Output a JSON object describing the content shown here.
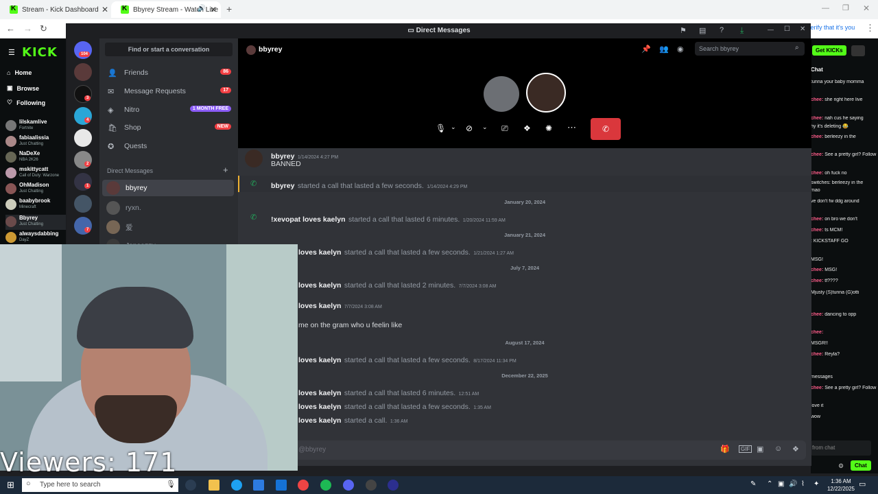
{
  "browser": {
    "tabs": [
      {
        "title": "Stream - Kick Dashboard"
      },
      {
        "title": "Bbyrey Stream - Watch Live"
      }
    ],
    "verify_text": "Verify that it's you"
  },
  "kick": {
    "logo": "KICK",
    "nav": [
      "Home",
      "Browse",
      "Following"
    ],
    "channels": [
      {
        "name": "lilskamlive",
        "category": "Fortnite"
      },
      {
        "name": "fabiaalissia",
        "category": "Just Chatting"
      },
      {
        "name": "NaDeXe",
        "category": "NBA 2K26"
      },
      {
        "name": "mskittycatt",
        "category": "Call of Duty: Warzone"
      },
      {
        "name": "OhMadison",
        "category": "Just Chatting"
      },
      {
        "name": "baabybrook",
        "category": "Minecraft"
      },
      {
        "name": "Bbyrey",
        "category": "Just Chatting"
      },
      {
        "name": "alwaysdabbing",
        "category": "DayZ"
      }
    ],
    "get_kicks": "Get KICKs",
    "chat_header": "Chat",
    "chat_lines": [
      {
        "user": "",
        "text": "tunna your baby momma"
      },
      {
        "user": "chee:",
        "text": "she right here live"
      },
      {
        "user": "chee:",
        "text": "nah cus he saying"
      },
      {
        "user": "",
        "text": "hy it's deleting 😂"
      },
      {
        "user": "chee:",
        "text": "berleezy in the"
      },
      {
        "user": "chee:",
        "text": "See a pretty girl? Follow"
      },
      {
        "user": "chee:",
        "text": "oh fuck no"
      },
      {
        "user": "",
        "text": "switches: berleezy in the"
      },
      {
        "user": "",
        "text": "mao"
      },
      {
        "user": "",
        "text": "ve don't fw ddg around"
      },
      {
        "user": "chee:",
        "text": "on bro we don't"
      },
      {
        "user": "chee:",
        "text": "ts MCM!"
      },
      {
        "user": "",
        "text": ": KICKSTAFF GO"
      },
      {
        "user": "",
        "text": "MSG!"
      },
      {
        "user": "chee:",
        "text": "MSG!"
      },
      {
        "user": "chee:",
        "text": "tf????"
      },
      {
        "user": "",
        "text": "Mjusty (S)tunna (G)otti"
      },
      {
        "user": "chee:",
        "text": "dancing to opp"
      },
      {
        "user": "chee:",
        "text": ""
      },
      {
        "user": "",
        "text": "MSGR!!"
      },
      {
        "user": "chee:",
        "text": "Reyla?"
      },
      {
        "user": "",
        "text": "messages"
      },
      {
        "user": "chee:",
        "text": "See a pretty girl? Follow"
      },
      {
        "user": "",
        "text": "love it"
      },
      {
        "user": "",
        "text": "wow"
      }
    ],
    "from_chat_placeholder": "from chat",
    "chat_button": "Chat",
    "viewers_label": "Viewers: 171"
  },
  "discord": {
    "window_title": "Direct Messages",
    "find_convo": "Find or start a conversation",
    "nav": [
      {
        "label": "Friends",
        "badge": "86",
        "icon": "friends-icon"
      },
      {
        "label": "Message Requests",
        "badge": "17",
        "icon": "envelope-icon"
      },
      {
        "label": "Nitro",
        "badge": "1 MONTH FREE",
        "icon": "nitro-icon"
      },
      {
        "label": "Shop",
        "badge": "NEW",
        "icon": "shop-icon"
      },
      {
        "label": "Quests",
        "badge": "",
        "icon": "quests-icon"
      }
    ],
    "dm_header": "Direct Messages",
    "dm_users": [
      "bbyrey",
      "ryxn.",
      "爱",
      "Jsneazzy"
    ],
    "server_badges": [
      "104",
      "",
      "3",
      "4",
      "",
      "2",
      "1",
      "",
      "7"
    ],
    "chat_user": "bbyrey",
    "search_placeholder": "Search bbyrey",
    "messages": [
      {
        "kind": "msg",
        "name": "bbyrey",
        "time": "1/14/2024 4:27 PM",
        "text": "BANNED"
      },
      {
        "kind": "call",
        "name": "bbyrey",
        "text": "started a call that lasted a few seconds.",
        "time": "1/14/2024 4:29 PM"
      },
      {
        "kind": "day",
        "text": "January 20, 2024"
      },
      {
        "kind": "call",
        "name": "!xevopat loves kaelyn",
        "text": "started a call that lasted 6 minutes.",
        "time": "1/20/2024 11:59 AM"
      },
      {
        "kind": "day",
        "text": "January 21, 2024"
      },
      {
        "kind": "call",
        "name": "loves kaelyn",
        "text": "started a call that lasted a few seconds.",
        "time": "1/21/2024 1:27 AM"
      },
      {
        "kind": "day",
        "text": "July 7, 2024"
      },
      {
        "kind": "call",
        "name": "loves kaelyn",
        "text": "started a call that lasted 2 minutes.",
        "time": "7/7/2024 3:08 AM"
      },
      {
        "kind": "msg2",
        "name": "loves kaelyn",
        "time": "7/7/2024 3:08 AM",
        "text": ""
      },
      {
        "kind": "text",
        "text": "me on the gram who u feelin like"
      },
      {
        "kind": "day",
        "text": "August 17, 2024"
      },
      {
        "kind": "call",
        "name": "loves kaelyn",
        "text": "started a call that lasted a few seconds.",
        "time": "8/17/2024 11:34 PM"
      },
      {
        "kind": "day",
        "text": "December 22, 2025"
      },
      {
        "kind": "call",
        "name": "loves kaelyn",
        "text": "started a call that lasted 6 minutes.",
        "time": "12:51 AM"
      },
      {
        "kind": "call",
        "name": "loves kaelyn",
        "text": "started a call that lasted a few seconds.",
        "time": "1:35 AM"
      },
      {
        "kind": "call",
        "name": "loves kaelyn",
        "text": "started a call.",
        "time": "1:36 AM"
      }
    ],
    "compose_placeholder": "@bbyrey"
  },
  "taskbar": {
    "search_placeholder": "Type here to search",
    "time": "1:36 AM",
    "date": "12/22/2025"
  },
  "colors": {
    "kick_green": "#53fc18",
    "discord_blurple": "#5865f2",
    "hangup_red": "#da373c",
    "call_green": "#23a55a"
  }
}
